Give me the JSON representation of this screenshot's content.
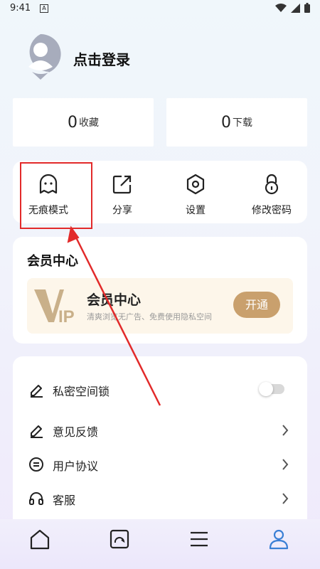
{
  "status_bar": {
    "time": "9:41",
    "notification_icon": "A"
  },
  "profile": {
    "login_label": "点击登录"
  },
  "stats": [
    {
      "count": "0",
      "label": "收藏"
    },
    {
      "count": "0",
      "label": "下载"
    }
  ],
  "quick_actions": [
    {
      "label": "无痕模式",
      "icon": "ghost-icon"
    },
    {
      "label": "分享",
      "icon": "share-icon"
    },
    {
      "label": "设置",
      "icon": "hexagon-settings-icon"
    },
    {
      "label": "修改密码",
      "icon": "lock-icon"
    }
  ],
  "member": {
    "section_title": "会员中心",
    "card_title": "会员中心",
    "card_subtitle": "清爽浏览无广告、免费使用隐私空间",
    "logo_text": "IP",
    "open_button": "开通"
  },
  "settings_list": [
    {
      "label": "私密空间锁",
      "control": "toggle",
      "toggle_on": false
    },
    {
      "label": "意见反馈",
      "control": "chevron"
    },
    {
      "label": "用户协议",
      "control": "chevron"
    },
    {
      "label": "客服",
      "control": "chevron"
    }
  ],
  "bottom_nav": [
    {
      "icon": "home-icon",
      "active": false
    },
    {
      "icon": "tabs-icon",
      "active": false
    },
    {
      "icon": "menu-icon",
      "active": false
    },
    {
      "icon": "profile-icon",
      "active": true
    }
  ],
  "colors": {
    "accent": "#3a7fd5",
    "gold": "#c9a06d",
    "highlight_red": "#e22a2a"
  }
}
